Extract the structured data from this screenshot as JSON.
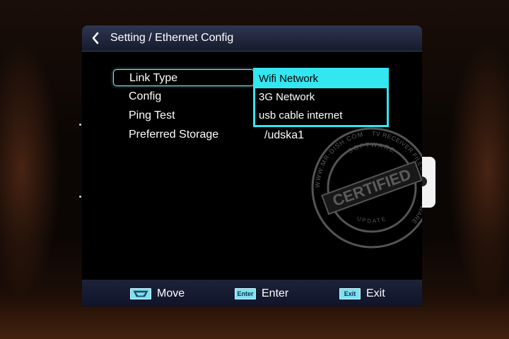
{
  "window": {
    "title": "Setting / Ethernet Config"
  },
  "menu": {
    "items": [
      {
        "label": "Link Type"
      },
      {
        "label": "Config"
      },
      {
        "label": "Ping Test"
      },
      {
        "label": "Preferred Storage",
        "value": "/udska1"
      }
    ]
  },
  "dropdown": {
    "options": [
      "Wifi Network",
      "3G Network",
      "usb cable internet"
    ],
    "selected": "Wifi Network"
  },
  "footer": {
    "move_label": "Move",
    "move_key": "",
    "enter_label": "Enter",
    "enter_key": "Enter",
    "exit_label": "Exit",
    "exit_key": "Exit"
  },
  "watermark": {
    "main": "CERTIFIED",
    "top": "SOFTWARE",
    "bottom": "UPDATE",
    "left_ring": "WWW.MR-DISH.COM",
    "right_ring": "TV RECEIVER FILES AND SOFTWARE"
  },
  "colors": {
    "highlight": "#33e6f0",
    "title_bar": "#2e3550",
    "footer_bar": "#1c2238",
    "key_icon": "#7fe0f0"
  },
  "icons": {
    "back": "chevron-left-icon",
    "move": "arrows-icon",
    "enter": "enter-key-icon",
    "exit": "exit-key-icon"
  }
}
